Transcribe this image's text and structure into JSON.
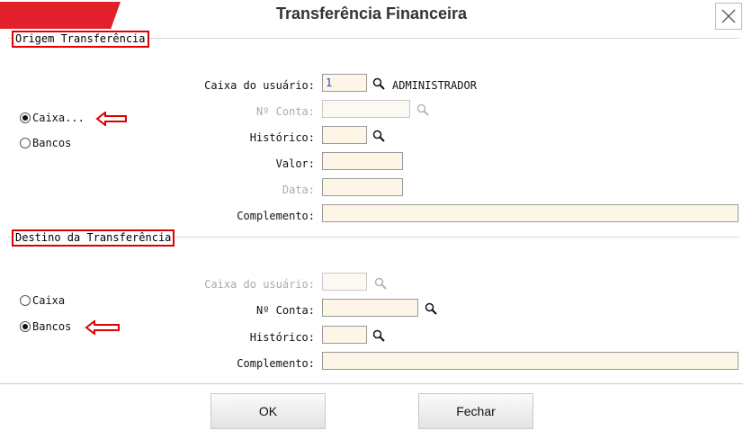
{
  "window": {
    "title": "Transferência Financeira"
  },
  "origem": {
    "section_label": "Origem Transferência",
    "radios": [
      {
        "label": "Caixa...",
        "selected": true
      },
      {
        "label": "Bancos",
        "selected": false
      }
    ],
    "fields": {
      "caixa_usuario": {
        "label": "Caixa do usuário:",
        "value": "1",
        "user_name": "ADMINISTRADOR"
      },
      "numero_conta": {
        "label": "Nº Conta:",
        "value": ""
      },
      "historico": {
        "label": "Histórico:",
        "value": ""
      },
      "valor": {
        "label": "Valor:",
        "value": ""
      },
      "data": {
        "label": "Data:",
        "value": ""
      },
      "complemento": {
        "label": "Complemento:",
        "value": ""
      }
    }
  },
  "destino": {
    "section_label": "Destino da Transferência",
    "radios": [
      {
        "label": "Caixa",
        "selected": false
      },
      {
        "label": "Bancos",
        "selected": true
      }
    ],
    "fields": {
      "caixa_usuario": {
        "label": "Caixa do usuário:",
        "value": ""
      },
      "numero_conta": {
        "label": "Nº Conta:",
        "value": ""
      },
      "historico": {
        "label": "Histórico:",
        "value": ""
      },
      "complemento": {
        "label": "Complemento:",
        "value": ""
      }
    }
  },
  "buttons": {
    "ok": "OK",
    "fechar": "Fechar"
  },
  "colors": {
    "accent": "#e2202c",
    "annotation": "#e00000",
    "field_bg": "#fdf6e6"
  },
  "icons": [
    "close-icon",
    "search-icon",
    "arrow-left-annotation-icon"
  ]
}
